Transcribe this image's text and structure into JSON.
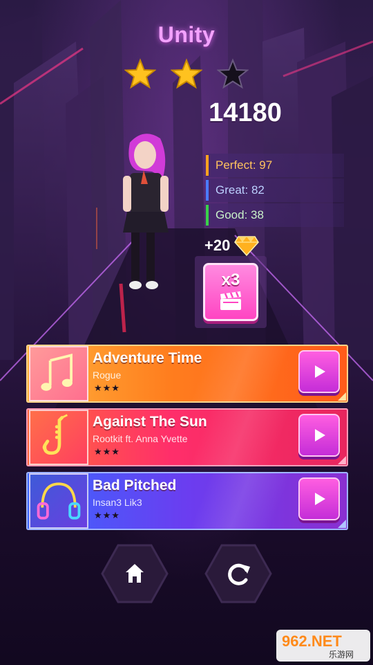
{
  "result": {
    "title": "Unity",
    "stars_earned": 2,
    "stars_total": 3,
    "score": "14180"
  },
  "stats": {
    "perfect": "Perfect: 97",
    "great": "Great: 82",
    "good": "Good: 38"
  },
  "reward": {
    "amount": "+20",
    "multiplier": "x3"
  },
  "songs": [
    {
      "title": "Adventure Time",
      "artist": "Rogue",
      "rating": "★★★",
      "icon": "music-note-icon"
    },
    {
      "title": "Against The Sun",
      "artist": "Rootkit ft. Anna Yvette",
      "rating": "★★★",
      "icon": "saxophone-icon"
    },
    {
      "title": "Bad Pitched",
      "artist": "Insan3 Lik3",
      "rating": "★★★",
      "icon": "headphones-icon"
    }
  ],
  "watermark": {
    "brand": "962.NET",
    "subtitle": "乐游网"
  },
  "colors": {
    "title": "#f3a2ff",
    "star_filled": "#ffc21f",
    "perfect": "#ffa21f",
    "great": "#4b7cff",
    "good": "#39d24a",
    "play_button": "#e040e0"
  }
}
